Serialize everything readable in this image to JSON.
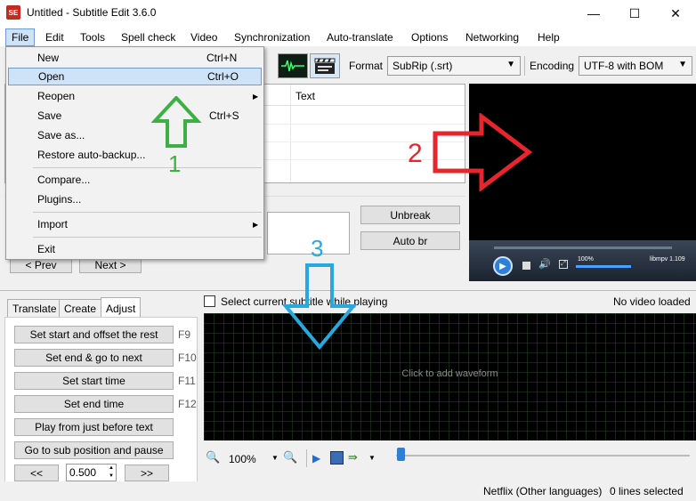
{
  "window": {
    "title": "Untitled - Subtitle Edit 3.6.0",
    "app_icon_text": "SE",
    "controls": [
      "—",
      "☐",
      "✕"
    ]
  },
  "menubar": [
    "File",
    "Edit",
    "Tools",
    "Spell check",
    "Video",
    "Synchronization",
    "Auto-translate",
    "Options",
    "Networking",
    "Help"
  ],
  "toolbar": {
    "format_label": "Format",
    "format_value": "SubRip (.srt)",
    "encoding_label": "Encoding",
    "encoding_value": "UTF-8 with BOM"
  },
  "grid": {
    "col_partial": "n",
    "col_text": "Text"
  },
  "edit": {
    "unbreak": "Unbreak",
    "auto_br": "Auto br",
    "prev": "< Prev",
    "next": "Next >"
  },
  "file_menu": {
    "items": [
      {
        "label": "New",
        "shortcut": "Ctrl+N"
      },
      {
        "label": "Open",
        "shortcut": "Ctrl+O"
      },
      {
        "label": "Reopen",
        "shortcut": ""
      },
      {
        "label": "Save",
        "shortcut": "Ctrl+S"
      },
      {
        "label": "Save as...",
        "shortcut": ""
      },
      {
        "label": "Restore auto-backup...",
        "shortcut": ""
      },
      {
        "label": "Compare...",
        "shortcut": ""
      },
      {
        "label": "Plugins...",
        "shortcut": ""
      },
      {
        "label": "Import",
        "shortcut": ""
      },
      {
        "label": "Exit",
        "shortcut": ""
      }
    ]
  },
  "video": {
    "volume": "100%",
    "player": "libmpv 1.109"
  },
  "lower": {
    "select_current_label": "Select current subtitle while playing",
    "no_video": "No video loaded",
    "waveform_hint": "Click to add waveform",
    "zoom_value": "100%",
    "tabs": [
      "Translate",
      "Create",
      "Adjust"
    ],
    "adjust_buttons": [
      {
        "label": "Set start and offset the rest",
        "key": "F9"
      },
      {
        "label": "Set end & go to next",
        "key": "F10"
      },
      {
        "label": "Set start time",
        "key": "F11"
      },
      {
        "label": "Set end time",
        "key": "F12"
      },
      {
        "label": "Play from just before text",
        "key": ""
      },
      {
        "label": "Go to sub position and pause",
        "key": ""
      }
    ],
    "step_back": "<<",
    "step_value": "0.500",
    "step_forward": ">>"
  },
  "status": {
    "profile": "Netflix (Other languages)",
    "lines_selected": "0 lines selected"
  },
  "annotations": [
    "1",
    "2",
    "3"
  ],
  "colors": {
    "annotation_green": "#3cb043",
    "annotation_red": "#e8242c",
    "annotation_blue": "#29a8e0",
    "menu_highlight": "#cfe3f8"
  }
}
